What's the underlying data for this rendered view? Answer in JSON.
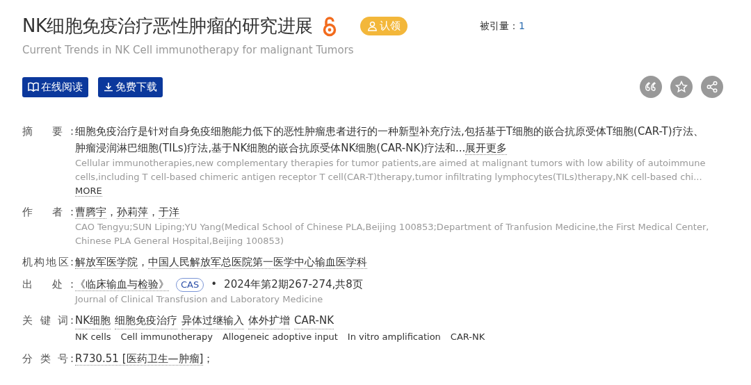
{
  "title": "NK细胞免疫治疗恶性肿瘤的研究进展",
  "claim_badge": "认领",
  "citations": {
    "label": "被引量：",
    "value": "1"
  },
  "subtitle": "Current Trends in NK Cell immunotherapy for malignant Tumors",
  "buttons": [
    {
      "label": "在线阅读",
      "kind": "read"
    },
    {
      "label": "免费下载",
      "kind": "download"
    }
  ],
  "actions": [
    {
      "kind": "quote"
    },
    {
      "kind": "star"
    },
    {
      "kind": "share"
    }
  ],
  "fields": [
    {
      "label": "摘 要:",
      "kind": "abstract",
      "text": "细胞免疫治疗是针对自身免疫细胞能力低下的恶性肿瘤患者进行的一种新型补充疗法,包括基于T细胞的嵌合抗原受体T细胞(CAR-T)疗法、肿瘤浸润淋巴细胞(TILs)疗法,基于NK细胞的嵌合抗原受体NK细胞(CAR-NK)疗法和...",
      "more": "展开更多",
      "en_text": "Cellular immunotherapies,new complementary therapies for tumor patients,are aimed at malignant tumors with low ability of autoimmune cells,including T cell-based chimeric antigen receptor T cell(CAR-T)therapy,tumor infiltrating lymphocytes(TILs)therapy,NK cell-based chi...",
      "en_more": "MORE"
    },
    {
      "label": "作 者:",
      "kind": "links",
      "links": [
        "曹腾宇",
        "孙莉萍",
        "于洋"
      ],
      "separator": "，",
      "en_text": "CAO Tengyu;SUN Liping;YU Yang(Medical School of Chinese PLA,Beijing 100853;Department of Tranfusion Medicine,the First Medical Center,Chinese PLA General Hospital,Beijing 100853)"
    },
    {
      "label": "机构地区:",
      "kind": "links",
      "links": [
        "解放军医学院",
        "中国人民解放军总医院第一医学中心输血医学科"
      ],
      "separator": "，"
    },
    {
      "label": "出 处:",
      "kind": "source",
      "journal": "《临床输血与检验》",
      "tag": "CAS",
      "bullet": "•",
      "issue": "2024年第2期267-274,共8页",
      "en_text": "Journal of Clinical Transfusion and Laboratory Medicine"
    },
    {
      "label": "关 键 词:",
      "kind": "keywords",
      "links": [
        "NK细胞",
        "细胞免疫治疗",
        "异体过继输入",
        "体外扩增",
        "CAR-NK"
      ],
      "en_words": [
        "NK cells",
        "Cell immunotherapy",
        "Allogeneic adoptive input",
        "In vitro amplification",
        "CAR-NK"
      ]
    },
    {
      "label": "分 类 号:",
      "kind": "links",
      "links": [
        "R730.51 [医药卫生—肿瘤]"
      ],
      "tail": "；"
    }
  ]
}
